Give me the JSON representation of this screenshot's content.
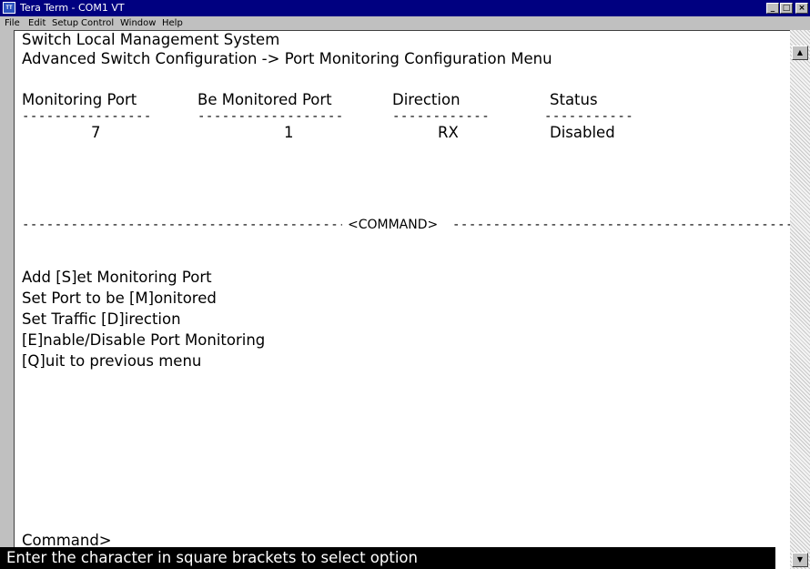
{
  "window": {
    "title": "Tera Term - COM1 VT",
    "icon_text": "TT"
  },
  "controls": {
    "minimize": "_",
    "maximize": "□",
    "close": "×"
  },
  "menu": {
    "items": [
      "File",
      "Edit",
      "Setup",
      "Control",
      "Window",
      "Help"
    ]
  },
  "terminal": {
    "header_line1": "Switch Local Management System",
    "header_line2": "Advanced Switch Configuration -> Port Monitoring Configuration Menu",
    "table": {
      "columns": [
        "Monitoring Port",
        "Be Monitored Port",
        "Direction",
        "Status"
      ],
      "rows": [
        [
          "7",
          "1",
          "RX",
          "Disabled"
        ]
      ]
    },
    "command_header": "<COMMAND>",
    "commands": [
      "Add [S]et Monitoring Port",
      "Set Port to be [M]onitored",
      "Set Traffic [D]irection",
      "[E]nable/Disable Port Monitoring",
      "[Q]uit to previous menu"
    ],
    "prompt": "Command>",
    "status_line": "Enter the character in square brackets to select option"
  }
}
